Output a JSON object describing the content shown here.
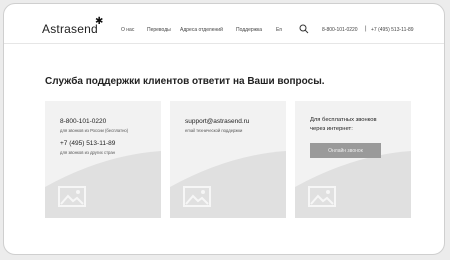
{
  "header": {
    "logo": "Astrasend",
    "logo_mark": "✱",
    "nav": [
      "О нас",
      "Переводы",
      "Адреса отделений",
      "Поддержка"
    ],
    "language": "En",
    "search_icon": "search-icon",
    "phone_1": "8-800-101-0220",
    "separator": "|",
    "phone_2": "+7 (495) 513-11-89"
  },
  "main": {
    "title": "Служба поддержки клиентов ответит на Ваши вопросы.",
    "cards": [
      {
        "line1": "8-800-101-0220",
        "sub1": "для звонков из России (бесплатно)",
        "line2": "+7 (495) 513-11-89",
        "sub2": "для звонков из других стран",
        "image_icon": "image-placeholder-icon"
      },
      {
        "line1": "support@astrasend.ru",
        "sub1": "email технической поддержки",
        "image_icon": "image-placeholder-icon"
      },
      {
        "line1": "Для бесплатных звонков",
        "line1b": "через интернет:",
        "button": "Онлайн звонок",
        "image_icon": "image-placeholder-icon"
      }
    ]
  },
  "colors": {
    "card_bg": "#f2f2f2",
    "button_bg": "#9a9a9a",
    "placeholder": "#e0e0e0"
  }
}
